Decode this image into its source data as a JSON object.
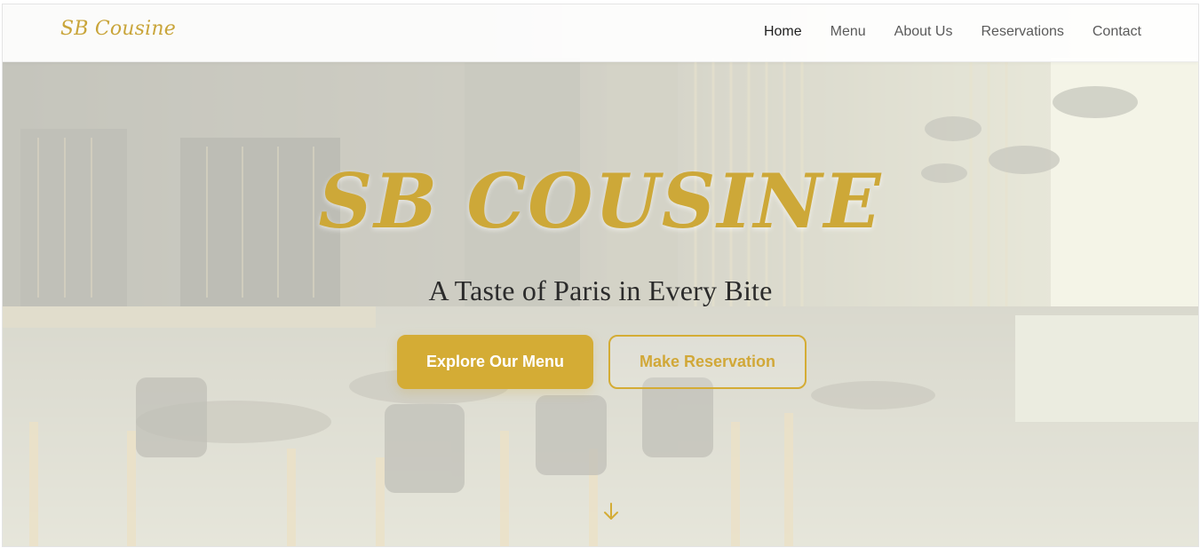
{
  "brand": {
    "name": "SB Cousine"
  },
  "nav": {
    "items": [
      {
        "label": "Home",
        "active": true
      },
      {
        "label": "Menu",
        "active": false
      },
      {
        "label": "About Us",
        "active": false
      },
      {
        "label": "Reservations",
        "active": false
      },
      {
        "label": "Contact",
        "active": false
      }
    ]
  },
  "hero": {
    "title": "SB COUSINE",
    "subtitle": "A Taste of Paris in Every Bite",
    "primary_button": "Explore Our Menu",
    "secondary_button": "Make Reservation",
    "scroll_icon": "arrow-down-icon"
  },
  "colors": {
    "accent": "#d4ac35",
    "brand_text": "#c9a53a",
    "nav_text": "#5a5a5a",
    "nav_active": "#1f1f1f",
    "subtitle_text": "#2b2b2b"
  }
}
